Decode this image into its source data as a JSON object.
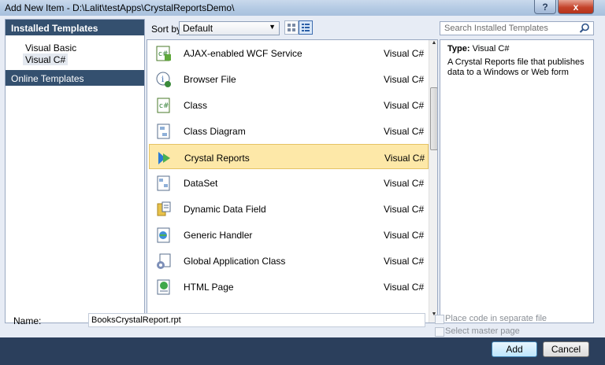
{
  "window": {
    "title": "Add New Item - D:\\Lalit\\testApps\\CrystalReportsDemo\\",
    "help_label": "?",
    "close_label": "x"
  },
  "left_panel": {
    "header": "Installed Templates",
    "items": [
      {
        "label": "Visual Basic"
      },
      {
        "label": "Visual C#"
      }
    ],
    "online": "Online Templates"
  },
  "toolbar": {
    "sort_label": "Sort by:",
    "sort_value": "Default"
  },
  "search": {
    "placeholder": "Search Installed Templates"
  },
  "templates": [
    {
      "name": "AJAX-enabled WCF Service",
      "lang": "Visual C#",
      "icon": "wcf-service-icon"
    },
    {
      "name": "Browser File",
      "lang": "Visual C#",
      "icon": "browser-file-icon"
    },
    {
      "name": "Class",
      "lang": "Visual C#",
      "icon": "class-icon"
    },
    {
      "name": "Class Diagram",
      "lang": "Visual C#",
      "icon": "class-diagram-icon"
    },
    {
      "name": "Crystal Reports",
      "lang": "Visual C#",
      "icon": "crystal-reports-icon",
      "selected": true
    },
    {
      "name": "DataSet",
      "lang": "Visual C#",
      "icon": "dataset-icon"
    },
    {
      "name": "Dynamic Data Field",
      "lang": "Visual C#",
      "icon": "dynamic-data-icon"
    },
    {
      "name": "Generic Handler",
      "lang": "Visual C#",
      "icon": "generic-handler-icon"
    },
    {
      "name": "Global Application Class",
      "lang": "Visual C#",
      "icon": "global-app-icon"
    },
    {
      "name": "HTML Page",
      "lang": "Visual C#",
      "icon": "html-page-icon"
    }
  ],
  "info": {
    "type_label": "Type:",
    "type_value": "Visual C#",
    "description": "A Crystal Reports file that publishes data to a Windows or Web form"
  },
  "name_field": {
    "label": "Name:",
    "value": "BooksCrystalReport.rpt"
  },
  "options": [
    {
      "label": "Place code in separate file"
    },
    {
      "label": "Select master page"
    }
  ],
  "buttons": {
    "add": "Add",
    "cancel": "Cancel"
  },
  "colors": {
    "header_bg": "#34506f",
    "selection": "#fde8a8",
    "footer_bg": "#2b3f5c"
  }
}
